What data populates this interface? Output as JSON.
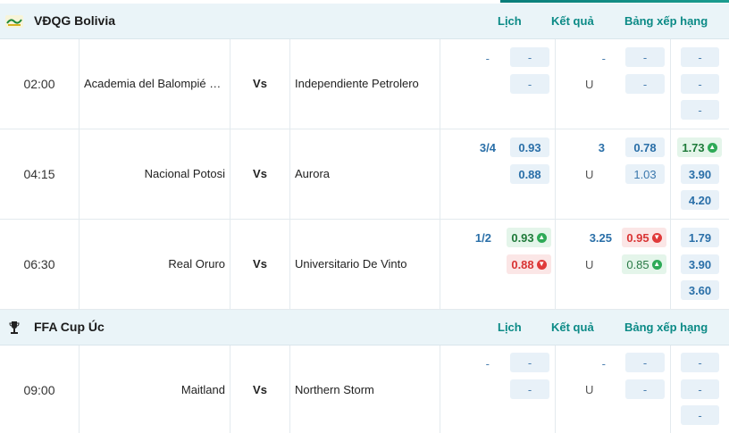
{
  "leagues": [
    {
      "name": "VĐQG Bolivia",
      "links": {
        "schedule": "Lịch",
        "results": "Kết quả",
        "standings": "Bảng xếp hạng"
      },
      "matches": [
        {
          "time": "02:00",
          "home": "Academia del Balompié Boliviano",
          "vs": "Vs",
          "away": "Independiente Petrolero",
          "hdp": "-",
          "hdp_home": "-",
          "hdp_away": "-",
          "ou": "-",
          "ou_over": "-",
          "ou_label": "U",
          "ou_under": "-",
          "x1": "-",
          "x2": "-",
          "x3": "-"
        },
        {
          "time": "04:15",
          "home": "Nacional Potosi",
          "vs": "Vs",
          "away": "Aurora",
          "hdp": "3/4",
          "hdp_home": "0.93",
          "hdp_away": "0.88",
          "ou": "3",
          "ou_over": "0.78",
          "ou_label": "U",
          "ou_under": "1.03",
          "x1": "1.73",
          "x2": "3.90",
          "x3": "4.20"
        },
        {
          "time": "06:30",
          "home": "Real Oruro",
          "vs": "Vs",
          "away": "Universitario De Vinto",
          "hdp": "1/2",
          "hdp_home": "0.93",
          "hdp_away": "0.88",
          "ou": "3.25",
          "ou_over": "0.95",
          "ou_label": "U",
          "ou_under": "0.85",
          "x1": "1.79",
          "x2": "3.90",
          "x3": "3.60"
        }
      ]
    },
    {
      "name": "FFA Cup Úc",
      "links": {
        "schedule": "Lịch",
        "results": "Kết quả",
        "standings": "Bảng xếp hạng"
      },
      "matches": [
        {
          "time": "09:00",
          "home": "Maitland",
          "vs": "Vs",
          "away": "Northern Storm",
          "hdp": "-",
          "hdp_home": "-",
          "hdp_away": "-",
          "ou": "-",
          "ou_over": "-",
          "ou_label": "U",
          "ou_under": "-",
          "x1": "-",
          "x2": "-",
          "x3": "-"
        }
      ]
    }
  ],
  "icons": {
    "up": "arrow-up-icon",
    "down": "arrow-down-icon"
  },
  "colors": {
    "accent": "#0b8a86",
    "odds_text": "#2a6fa8",
    "odds_bg": "#e8f1f8",
    "up": "#2eaa57",
    "down": "#e03a3a"
  }
}
